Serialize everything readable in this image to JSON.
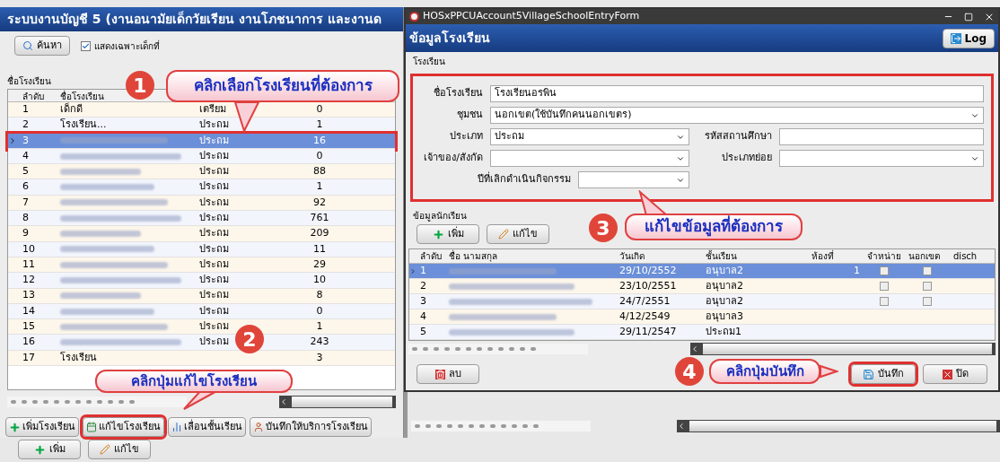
{
  "main_window": {
    "title": "ระบบงานบัญชี 5 (งานอนามัยเด็กวัยเรียน งานโภชนาการ และงานด",
    "search_button": "ค้นหา",
    "filter_checkbox": {
      "label": "แสดงเฉพาะเด็กที่",
      "checked": true
    },
    "group_label": "ชื่อโรงเรียน",
    "columns": [
      "ลำดับ",
      "ชื่อโรงเรียน"
    ],
    "rows": [
      {
        "no": "1",
        "name": "เด็กดี",
        "type": "เตรียม",
        "count": "0",
        "selected": false
      },
      {
        "no": "2",
        "name": "โรงเรียน...",
        "type": "ประถม",
        "count": "1",
        "selected": false
      },
      {
        "no": "3",
        "type": "ประถม",
        "count": "16",
        "selected": true,
        "highlighted": true
      },
      {
        "no": "4",
        "type": "ประถม",
        "count": "0",
        "selected": false
      },
      {
        "no": "5",
        "type": "ประถม",
        "count": "88",
        "selected": false
      },
      {
        "no": "6",
        "type": "ประถม",
        "count": "1",
        "selected": false
      },
      {
        "no": "7",
        "type": "ประถม",
        "count": "92",
        "selected": false
      },
      {
        "no": "8",
        "type": "ประถม",
        "count": "761",
        "selected": false
      },
      {
        "no": "9",
        "type": "ประถม",
        "count": "209",
        "selected": false
      },
      {
        "no": "10",
        "type": "ประถม",
        "count": "11",
        "selected": false
      },
      {
        "no": "11",
        "type": "ประถม",
        "count": "29",
        "selected": false
      },
      {
        "no": "12",
        "type": "ประถม",
        "count": "10",
        "selected": false
      },
      {
        "no": "13",
        "type": "ประถม",
        "count": "8",
        "selected": false
      },
      {
        "no": "14",
        "type": "ประถม",
        "count": "0",
        "selected": false
      },
      {
        "no": "15",
        "type": "ประถม",
        "count": "1",
        "selected": false
      },
      {
        "no": "16",
        "type": "ประถม",
        "count": "243",
        "selected": false
      },
      {
        "no": "17",
        "name": "โรงเรียน",
        "count": "3",
        "selected": false
      }
    ],
    "buttons": [
      {
        "label": "เพิ่มโรงเรียน",
        "highlighted": false
      },
      {
        "label": "แก้ไขโรงเรียน",
        "highlighted": true
      },
      {
        "label": "เลื่อนชั้นเรียน",
        "highlighted": false
      },
      {
        "label": "บันทึกให้บริการโรงเรียน",
        "highlighted": false
      }
    ],
    "bottom_buttons": [
      "เพิ่ม",
      "แก้ไข"
    ]
  },
  "dialog": {
    "title": "HOSxPPCUAccount5VillageSchoolEntryForm",
    "header": "ข้อมูลโรงเรียน",
    "log_button": "Log",
    "school_group": "โรงเรียน",
    "form_highlighted": true,
    "fields": {
      "school_name": {
        "label": "ชื่อโรงเรียน",
        "value": "โรงเรียนอรพิน"
      },
      "community": {
        "label": "ชุมชน",
        "value": "นอกเขต(ใช้บันทึกคนนอกเขตร)"
      },
      "type": {
        "label": "ประเภท",
        "value": "ประถม"
      },
      "school_code": {
        "label": "รหัสสถานศึกษา"
      },
      "owner": {
        "label": "เจ้าของ/สังกัด"
      },
      "subtype": {
        "label": "ประเภทย่อย"
      },
      "closed_year": {
        "label": "ปีที่เลิกดำเนินกิจกรรม"
      }
    },
    "student_group": "ข้อมูลนักเรียน",
    "student_buttons": [
      "เพิ่ม",
      "แก้ไข"
    ],
    "columns": [
      "ลำดับ",
      "ชื่อ นามสกุล",
      "วันเกิด",
      "ชั้นเรียน",
      "ห้องที่",
      "จำหน่าย",
      "นอกเขต",
      "disch"
    ],
    "students": [
      {
        "no": "1",
        "birth": "29/10/2552",
        "class": "อนุบาล2",
        "room": "1",
        "discharged": false,
        "outside": false,
        "selected": true
      },
      {
        "no": "2",
        "birth": "23/10/2551",
        "class": "อนุบาล2",
        "discharged": false,
        "outside": false,
        "selected": false
      },
      {
        "no": "3",
        "birth": "24/7/2551",
        "class": "อนุบาล2",
        "discharged": false,
        "outside": false,
        "selected": false
      },
      {
        "no": "4",
        "birth": "4/12/2549",
        "class": "อนุบาล3",
        "selected": false
      },
      {
        "no": "5",
        "birth": "29/11/2547",
        "class": "ประถม1",
        "selected": false
      }
    ],
    "delete_button": "ลบ",
    "save_button": {
      "label": "บันทึก",
      "highlighted": true
    },
    "close_button": "ปิด"
  },
  "callouts": [
    {
      "number": "1",
      "text": "คลิกเลือกโรงเรียนที่ต้องการ"
    },
    {
      "number": "2",
      "text": "คลิกปุ่มแก้ไขโรงเรียน"
    },
    {
      "number": "3",
      "text": "แก้ไขข้อมูลที่ต้องการ"
    },
    {
      "number": "4",
      "text": "คลิกปุ่มบันทึก"
    }
  ]
}
